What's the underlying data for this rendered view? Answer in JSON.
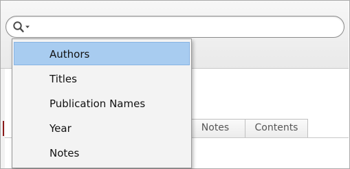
{
  "search": {
    "value": "",
    "placeholder": "",
    "menu_icon": "search-icon",
    "menu_arrow_icon": "dropdown-arrow-icon"
  },
  "search_menu": {
    "selected_index": 0,
    "items": [
      {
        "label": "Authors"
      },
      {
        "label": "Titles"
      },
      {
        "label": "Publication Names"
      },
      {
        "label": "Year"
      },
      {
        "label": "Notes"
      }
    ]
  },
  "tabs": [
    {
      "label": "Notes"
    },
    {
      "label": "Contents"
    }
  ],
  "colors": {
    "selection_fill": "#a8ccf0",
    "selection_border": "#86b3e3",
    "menu_background": "#f3f3f3",
    "left_marker": "#8b1a1a"
  }
}
